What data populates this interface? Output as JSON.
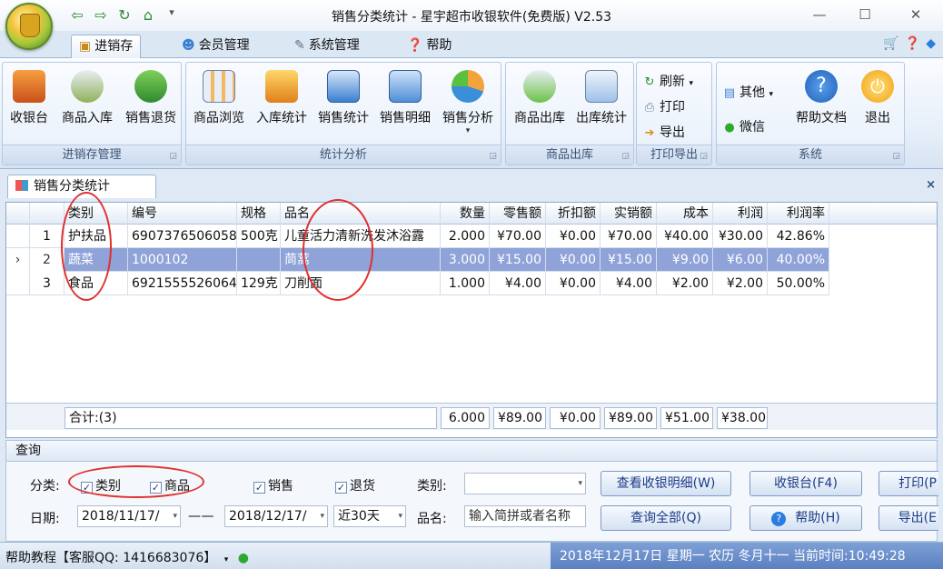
{
  "window": {
    "title": "销售分类统计 - 星宇超市收银软件(免费版) V2.53",
    "controls": [
      "—",
      "☐",
      "✕"
    ]
  },
  "quick_access": [
    "⇦",
    "⇨",
    "↻",
    "⌂",
    "▾"
  ],
  "ribbon_tabs": [
    {
      "label": "进销存",
      "icon": "box-icon"
    },
    {
      "label": "会员管理",
      "icon": "people-icon"
    },
    {
      "label": "系统管理",
      "icon": "tools-icon"
    },
    {
      "label": "帮助",
      "icon": "help-icon"
    }
  ],
  "ribbon_right_icons": [
    "cart-icon",
    "help-icon",
    "skin-icon"
  ],
  "groups": {
    "jxc": {
      "label": "进销存管理",
      "buttons": [
        "收银台",
        "商品入库",
        "销售退货"
      ]
    },
    "stats": {
      "label": "统计分析",
      "buttons": [
        "商品浏览",
        "入库统计",
        "销售统计",
        "销售明细",
        "销售分析"
      ]
    },
    "out": {
      "label": "商品出库",
      "buttons": [
        "商品出库",
        "出库统计"
      ]
    },
    "print": {
      "label": "打印导出",
      "buttons": [
        "刷新",
        "打印",
        "导出"
      ]
    },
    "system": {
      "label": "系统",
      "small": [
        "其他",
        "微信"
      ],
      "buttons": [
        "帮助文档",
        "退出"
      ]
    }
  },
  "doc_tab": {
    "label": "销售分类统计",
    "close": "×"
  },
  "grid": {
    "columns": [
      "类别",
      "编号",
      "规格",
      "品名",
      "数量",
      "零售额",
      "折扣额",
      "实销额",
      "成本",
      "利润",
      "利润率"
    ],
    "rows": [
      {
        "marker": "",
        "no": "1",
        "cells": [
          "护扶品",
          "6907376506058",
          "500克",
          "儿童活力清新洗发沐浴露",
          "2.000",
          "¥70.00",
          "¥0.00",
          "¥70.00",
          "¥40.00",
          "¥30.00",
          "42.86%"
        ]
      },
      {
        "marker": "›",
        "no": "2",
        "cells": [
          "蔬菜",
          "1000102",
          "",
          "茼蒿",
          "3.000",
          "¥15.00",
          "¥0.00",
          "¥15.00",
          "¥9.00",
          "¥6.00",
          "40.00%"
        ]
      },
      {
        "marker": "",
        "no": "3",
        "cells": [
          "食品",
          "6921555526064",
          "129克",
          "刀削面",
          "1.000",
          "¥4.00",
          "¥0.00",
          "¥4.00",
          "¥2.00",
          "¥2.00",
          "50.00%"
        ]
      }
    ],
    "selected_row": 2,
    "totals": {
      "label": "合计:(3)",
      "qty": "6.000",
      "retail": "¥89.00",
      "discount": "¥0.00",
      "actual": "¥89.00",
      "cost": "¥51.00",
      "profit": "¥38.00"
    }
  },
  "query": {
    "title": "查询",
    "classify_label": "分类:",
    "check_category": "类别",
    "check_goods": "商品",
    "check_sales": "销售",
    "check_returns": "退货",
    "category_label": "类别:",
    "category_value": "",
    "date_label": "日期:",
    "date_from": "2018/11/17/",
    "date_sep": "— —",
    "date_to": "2018/12/17/",
    "range": "近30天",
    "name_label": "品名:",
    "name_placeholder": "输入简拼或者名称",
    "btn_detail": "查看收银明细(W)",
    "btn_all": "查询全部(Q)",
    "btn_pos": "收银台(F4)",
    "btn_help": "帮助(H)",
    "btn_print": "打印(P",
    "btn_export": "导出(E"
  },
  "status": {
    "left": "帮助教程【客服QQ: 1416683076】",
    "right": "2018年12月17日 星期一 农历 冬月十一 当前时间:10:49:28"
  },
  "colors": {
    "selected_row": "#8fa3d9",
    "annotation": "#e03030",
    "status_right": "#5a7fc0"
  }
}
